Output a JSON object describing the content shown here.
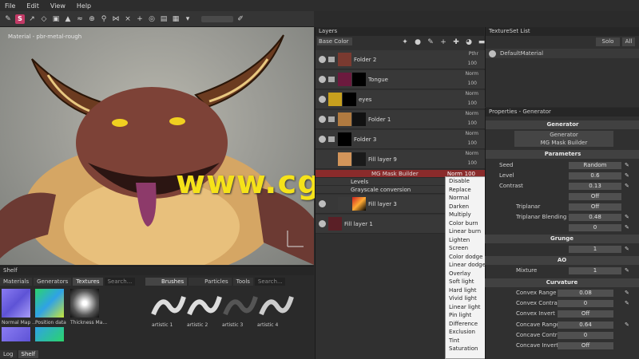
{
  "menu": [
    "File",
    "Edit",
    "View",
    "Help"
  ],
  "viewport": {
    "label": "Material - pbr-metal-rough"
  },
  "watermark": "www.cgtsj.com",
  "layers_panel": {
    "title": "Layers",
    "channel_select": "Base Color",
    "layers": [
      {
        "name": "Folder 2",
        "blend": "Pthr",
        "opacity": "100",
        "type": "folder"
      },
      {
        "name": "Tongue",
        "blend": "Norm",
        "opacity": "100",
        "type": "folder"
      },
      {
        "name": "eyes",
        "blend": "Norm",
        "opacity": "100",
        "type": "layer"
      },
      {
        "name": "Folder 1",
        "blend": "Norm",
        "opacity": "100",
        "type": "folder"
      },
      {
        "name": "Folder 3",
        "blend": "Norm",
        "opacity": "100",
        "type": "folder"
      },
      {
        "name": "Fill layer 9",
        "blend": "Norm",
        "opacity": "100",
        "type": "layer"
      },
      {
        "name": "MG Mask Builder",
        "blend": "Norm",
        "opacity": "100",
        "type": "effect"
      },
      {
        "name": "Levels",
        "blend": "",
        "opacity": "",
        "type": "effect"
      },
      {
        "name": "Grayscale conversion",
        "blend": "",
        "opacity": "",
        "type": "effect"
      },
      {
        "name": "Fill layer 3",
        "blend": "",
        "opacity": "",
        "type": "layer"
      },
      {
        "name": "Fill layer 1",
        "blend": "",
        "opacity": "",
        "type": "layer"
      }
    ]
  },
  "blend_menu": {
    "items": [
      "Disable",
      "Replace",
      "Normal",
      "Darken",
      "Multiply",
      "Color burn",
      "Linear burn",
      "Lighten",
      "Screen",
      "Color dodge",
      "Linear dodge",
      "Overlay",
      "Soft light",
      "Hard light",
      "Vivid light",
      "Linear light",
      "Pin light",
      "Difference",
      "Exclusion",
      "Tint",
      "Saturation"
    ]
  },
  "textureset": {
    "title": "TextureSet List",
    "solo_label": "Solo",
    "all_label": "All",
    "item": "DefaultMaterial"
  },
  "properties": {
    "title": "Properties - Generator",
    "generator_head": "Generator",
    "generator_name": "Generator",
    "generator_value": "MG Mask Builder",
    "parameters_head": "Parameters",
    "params": [
      {
        "label": "Seed",
        "value": "Random"
      },
      {
        "label": "Level",
        "value": "0.6"
      },
      {
        "label": "Contrast",
        "value": "0.13"
      },
      {
        "label": "",
        "value": "Off"
      },
      {
        "label": "Triplanar",
        "value": "Off"
      },
      {
        "label": "Triplanar Blending Contrast",
        "value": "0.48"
      },
      {
        "label": "",
        "value": "0"
      }
    ],
    "grunge_head": "Grunge",
    "grunge_value": "1",
    "ao_head": "AO",
    "ao_label": "Mixture",
    "ao_value": "1",
    "curvature_head": "Curvature",
    "curvature": [
      {
        "label": "Convex Range",
        "value": "0.08"
      },
      {
        "label": "Convex Contrast",
        "value": "0"
      },
      {
        "label": "Convex Invert",
        "value": "Off"
      },
      {
        "label": "Concave Range",
        "value": "0.64"
      },
      {
        "label": "Concave Contrast",
        "value": "0"
      },
      {
        "label": "Concave Invert",
        "value": "Off"
      }
    ]
  },
  "shelf": {
    "title": "Shelf",
    "tabs": [
      "Materials",
      "Generators",
      "Textures"
    ],
    "search_placeholder": "Search...",
    "thumbs": [
      "Normal Map ...",
      "Position data",
      "Thickness Ma..."
    ],
    "right_tabs": [
      "Brushes",
      "Particles",
      "Tools"
    ],
    "brushes": [
      "artistic 1",
      "artistic 2",
      "artistic 3",
      "artistic 4"
    ],
    "bottom_tabs": [
      "Log",
      "Shelf"
    ]
  }
}
